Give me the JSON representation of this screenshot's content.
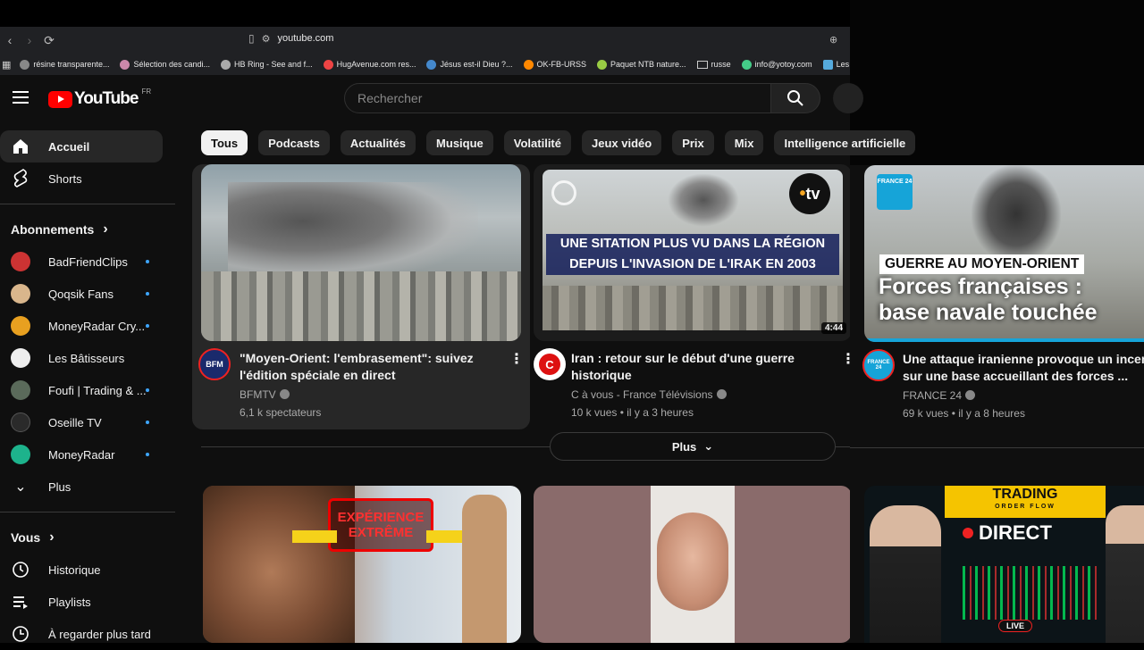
{
  "browser": {
    "url": "youtube.com",
    "bookmarks": [
      "résine transparente...",
      "Sélection des candi...",
      "HB Ring - See and f...",
      "HugAvenue.com res...",
      "Jésus est-il Dieu ?...",
      "OK-FB-URSS",
      "Paquet NTB nature...",
      "russe",
      "info@yotoy.com",
      "Les conc"
    ]
  },
  "masthead": {
    "logo_text": "YouTube",
    "country": "FR",
    "search_placeholder": "Rechercher"
  },
  "sidebar": {
    "home": "Accueil",
    "shorts": "Shorts",
    "subscriptions_title": "Abonnements",
    "subscriptions": [
      "BadFriendClips",
      "Qoqsik Fans",
      "MoneyRadar Cry...",
      "Les Bâtisseurs",
      "Foufi | Trading & ...",
      "Oseille TV",
      "MoneyRadar"
    ],
    "more": "Plus",
    "you_title": "Vous",
    "history": "Historique",
    "playlists": "Playlists",
    "watch_later": "À regarder plus tard"
  },
  "chips": [
    "Tous",
    "Podcasts",
    "Actualités",
    "Musique",
    "Volatilité",
    "Jeux vidéo",
    "Prix",
    "Mix",
    "Intelligence artificielle"
  ],
  "videos": [
    {
      "title_line1": "\"Moyen-Orient: l'embrasement\": suivez",
      "title_line2": "l'édition spéciale en direct",
      "channel": "BFMTV",
      "meta": "6,1 k spectateurs",
      "avatar_text": "BFM"
    },
    {
      "title_line1": "Iran :  retour sur le début d'une guerre",
      "title_line2": "historique",
      "channel": "C à vous - France Télévisions",
      "meta": "10 k vues • il y a 3 heures",
      "duration": "4:44",
      "thumb_text1": "UNE SITATION PLUS VU DANS LA RÉGION",
      "thumb_text2": "DEPUIS L'INVASION DE L'IRAK EN 2003",
      "thumb_logo": "tv",
      "avatar_text": "C"
    },
    {
      "title_line1": "Une attaque iranienne provoque un incendie",
      "title_line2": "sur une base accueillant des forces ...",
      "channel": "FRANCE 24",
      "meta": "69 k vues • il y a 8 heures",
      "thumb_banner": "GUERRE AU MOYEN-ORIENT",
      "thumb_title1": "Forces françaises :",
      "thumb_title2": "base navale touchée",
      "thumb_logo": "FRANCE 24",
      "avatar_text": "FRANCE 24"
    }
  ],
  "more_button": "Plus",
  "row2": {
    "v1_badge": "EXPÉRIENCE EXTRÊME",
    "v3_top": "TRADING",
    "v3_sub": "ORDER FLOW",
    "v3_direct": "DIRECT",
    "v3_live": "LIVE"
  }
}
